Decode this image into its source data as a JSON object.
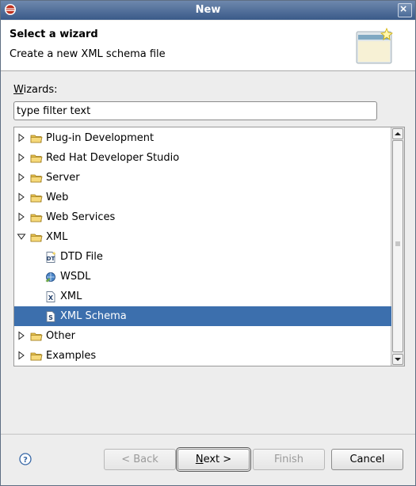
{
  "window": {
    "title": "New"
  },
  "header": {
    "title": "Select a wizard",
    "description": "Create a new XML schema file"
  },
  "wizards": {
    "label_prefix": "W",
    "label_rest": "izards:",
    "filter_value": "type filter text"
  },
  "tree": {
    "items": [
      {
        "label": "Plug-in Development",
        "kind": "folder",
        "expanded": false,
        "depth": 0,
        "icon": "folder-icon"
      },
      {
        "label": "Red Hat Developer Studio",
        "kind": "folder",
        "expanded": false,
        "depth": 0,
        "icon": "folder-icon"
      },
      {
        "label": "Server",
        "kind": "folder",
        "expanded": false,
        "depth": 0,
        "icon": "folder-icon"
      },
      {
        "label": "Web",
        "kind": "folder",
        "expanded": false,
        "depth": 0,
        "icon": "folder-icon"
      },
      {
        "label": "Web Services",
        "kind": "folder",
        "expanded": false,
        "depth": 0,
        "icon": "folder-icon"
      },
      {
        "label": "XML",
        "kind": "folder",
        "expanded": true,
        "depth": 0,
        "icon": "folder-icon"
      },
      {
        "label": "DTD File",
        "kind": "item",
        "depth": 1,
        "icon": "dtd-file-icon"
      },
      {
        "label": "WSDL",
        "kind": "item",
        "depth": 1,
        "icon": "wsdl-icon"
      },
      {
        "label": "XML",
        "kind": "item",
        "depth": 1,
        "icon": "xml-file-icon"
      },
      {
        "label": "XML Schema",
        "kind": "item",
        "depth": 1,
        "icon": "xml-schema-icon",
        "selected": true
      },
      {
        "label": "Other",
        "kind": "folder",
        "expanded": false,
        "depth": 0,
        "icon": "folder-icon"
      },
      {
        "label": "Examples",
        "kind": "folder",
        "expanded": false,
        "depth": 0,
        "icon": "folder-icon"
      }
    ]
  },
  "buttons": {
    "back": "< Back",
    "next": "Next >",
    "finish": "Finish",
    "cancel": "Cancel"
  },
  "colors": {
    "selection": "#3c6fad",
    "titlebar": "#4a6a98"
  }
}
